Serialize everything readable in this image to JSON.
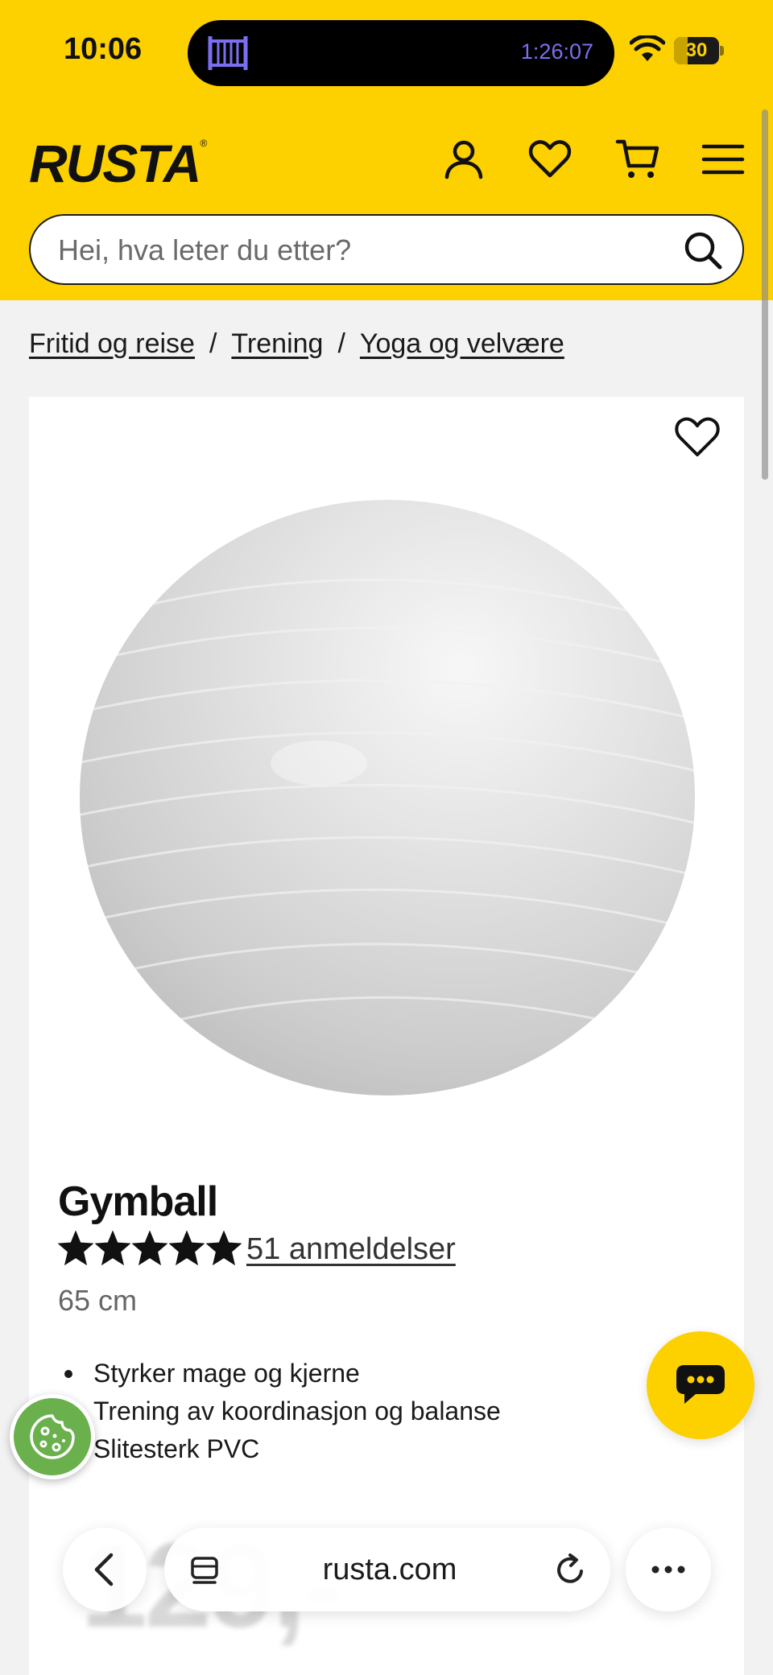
{
  "status_bar": {
    "time": "10:06",
    "live_activity_timer": "1:26:07",
    "battery_level": "30",
    "battery_fraction": 0.3,
    "icons": [
      "crib-icon",
      "wifi-icon",
      "battery-icon"
    ]
  },
  "header": {
    "logo": "RUSTA",
    "logo_mark": "®",
    "icons": [
      "account-icon",
      "heart-icon",
      "cart-icon",
      "menu-icon"
    ],
    "brand_color": "#fdd000"
  },
  "search": {
    "placeholder": "Hei, hva leter du etter?"
  },
  "breadcrumb": {
    "items": [
      "Fritid og reise",
      "Trening",
      "Yoga og velvære"
    ],
    "separator": "/"
  },
  "product": {
    "title": "Gymball",
    "rating": 5,
    "rating_max": 5,
    "reviews_label": "51 anmeldelser",
    "variant": "65 cm",
    "features": [
      "Styrker mage og kjerne",
      "Trening av koordinasjon og balanse",
      "Slitesterk PVC"
    ],
    "price_partial": "129,-",
    "image": "white-exercise-ball"
  },
  "browser": {
    "domain": "rusta.com",
    "icons": [
      "back-icon",
      "tabs-icon",
      "reload-icon",
      "more-icon"
    ]
  },
  "floating": {
    "chat_icon": "chat-icon",
    "cookie_icon": "cookie-icon",
    "cookie_color": "#6ab04c"
  }
}
